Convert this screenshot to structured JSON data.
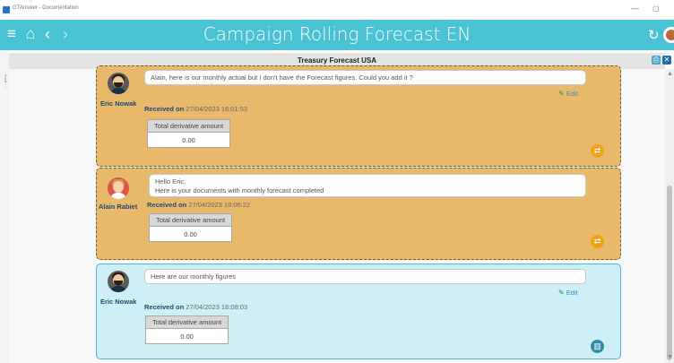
{
  "window": {
    "app_title": "GTAnswer - Documentation",
    "min_glyph": "—",
    "max_glyph": "▢"
  },
  "header": {
    "title": "Campaign Rolling Forecast EN",
    "menu_glyph": "≡",
    "home_glyph": "⌂",
    "back_glyph": "‹",
    "forward_glyph": "›",
    "refresh_glyph": "↻"
  },
  "panel": {
    "title": "Treasury Forecast USA",
    "print_glyph": "⎙",
    "close_glyph": "✕"
  },
  "left_strip": {
    "glyph1": "[",
    "glyph2": "·"
  },
  "scrollbar": {
    "up_glyph": "▲",
    "down_glyph": "▼"
  },
  "messages": [
    {
      "author": "Eric Nowak",
      "text_lines": [
        "Alain, here is our monthly actual but I don't have the Forecast figures. Could you add it ?"
      ],
      "received_label": "Received on",
      "received_date": "27/04/2023 16:01:53",
      "edit_label": "Edit",
      "amount_label": "Total derivative amount",
      "amount_value": "0.00",
      "style": "out",
      "action_icon": "edit-cycle-icon"
    },
    {
      "author": "Alain Rabiet",
      "text_lines": [
        "Hello Eric,",
        "Here is your documents with monthly forecast completed"
      ],
      "received_label": "Received on",
      "received_date": "27/04/2023 16:06:22",
      "amount_label": "Total derivative amount",
      "amount_value": "0.00",
      "style": "out",
      "action_icon": "edit-cycle-icon"
    },
    {
      "author": "Eric Nowak",
      "text_lines": [
        "Here are our monthly figures"
      ],
      "received_label": "Received on",
      "received_date": "27/04/2023 16:08:03",
      "edit_label": "Edit",
      "amount_label": "Total derivative amount",
      "amount_value": "0.00",
      "style": "in",
      "action_icon": "building-icon"
    }
  ],
  "icons": {
    "pen_glyph": "✎",
    "cycle_glyph": "⇄",
    "building_glyph": "▥"
  },
  "colors": {
    "header": "#49c3d4",
    "out_card": "#e8b96a",
    "in_card": "#cdeff5",
    "action_orange": "#f0a214",
    "action_teal": "#2e8ea8"
  }
}
